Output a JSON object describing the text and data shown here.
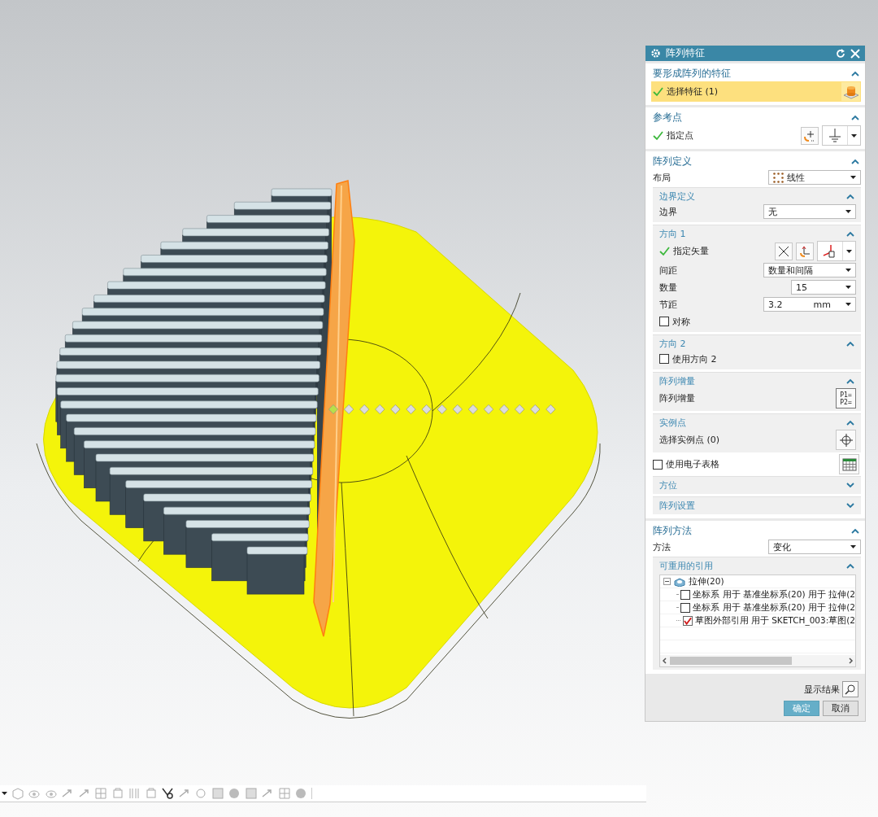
{
  "dialog": {
    "title": "阵列特征"
  },
  "sections": [
    {
      "title": "要形成阵列的特征",
      "expanded": true,
      "items": [
        {
          "kind": "feature-select",
          "label": "选择特征 (1)",
          "done": true,
          "highlighted": true
        }
      ]
    },
    {
      "title": "参考点",
      "expanded": true,
      "items": [
        {
          "kind": "point-select",
          "label": "指定点",
          "done": true,
          "highlighted": false
        }
      ]
    },
    {
      "title": "阵列定义",
      "expanded": true,
      "items": [
        {
          "kind": "layout-dropdown",
          "label": "布局",
          "value": "线性"
        },
        {
          "kind": "group",
          "title": "边界定义",
          "expanded": true,
          "items": [
            {
              "kind": "dropdown",
              "label": "边界",
              "value": "无"
            }
          ]
        },
        {
          "kind": "group",
          "title": "方向 1",
          "expanded": true,
          "items": [
            {
              "kind": "vector-select",
              "label": "指定矢量",
              "done": true,
              "highlighted": false
            },
            {
              "kind": "dropdown",
              "label": "间距",
              "value": "数量和间隔"
            },
            {
              "kind": "count",
              "label": "数量",
              "value": "15"
            },
            {
              "kind": "length",
              "label": "节距",
              "value": "3.2",
              "unit": "mm"
            },
            {
              "kind": "checkbox",
              "label": "对称",
              "checked": false
            }
          ]
        },
        {
          "kind": "group",
          "title": "方向 2",
          "expanded": true,
          "items": [
            {
              "kind": "checkbox",
              "label": "使用方向 2",
              "checked": false
            }
          ]
        },
        {
          "kind": "group",
          "title": "阵列增量",
          "expanded": true,
          "items": [
            {
              "kind": "increment",
              "label": "阵列增量",
              "lines": [
                "P1=",
                "P2="
              ]
            }
          ]
        },
        {
          "kind": "group",
          "title": "实例点",
          "expanded": true,
          "items": [
            {
              "kind": "instance-select",
              "label": "选择实例点 (0)"
            }
          ]
        },
        {
          "kind": "spreadsheet",
          "label": "使用电子表格",
          "checked": false
        },
        {
          "kind": "group",
          "title": "方位",
          "expanded": false
        },
        {
          "kind": "group",
          "title": "阵列设置",
          "expanded": false
        }
      ]
    },
    {
      "title": "阵列方法",
      "expanded": true,
      "items": [
        {
          "kind": "dropdown",
          "label": "方法",
          "value": "变化"
        },
        {
          "kind": "group",
          "title": "可重用的引用",
          "expanded": true,
          "items": [
            {
              "kind": "tree",
              "nodes": [
                {
                  "label": "拉伸(20)",
                  "expanded": true,
                  "children": [
                    {
                      "label": "坐标系 用于 基准坐标系(20) 用于 拉伸(2",
                      "checked": false
                    },
                    {
                      "label": "坐标系 用于 基准坐标系(20) 用于 拉伸(2",
                      "checked": false
                    },
                    {
                      "label": "草图外部引用 用于 SKETCH_003:草图(2",
                      "checked": true
                    }
                  ]
                }
              ]
            }
          ]
        }
      ]
    }
  ],
  "footer": {
    "preview_label": "显示结果",
    "buttons": [
      {
        "label": "确定",
        "default": true
      },
      {
        "label": "取消",
        "default": false
      }
    ]
  }
}
